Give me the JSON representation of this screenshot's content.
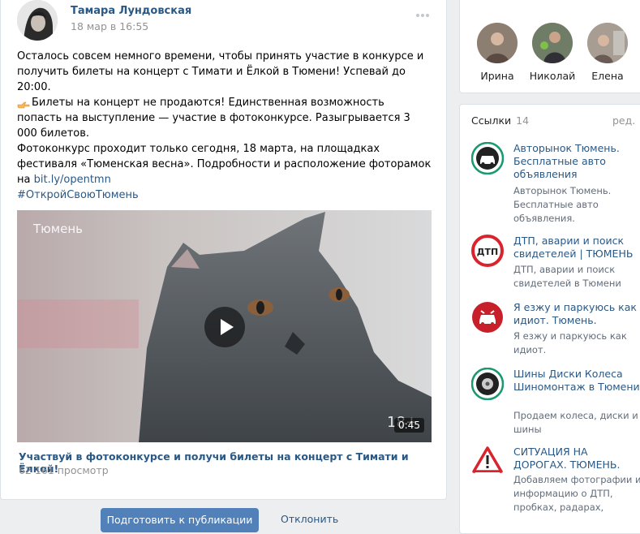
{
  "post": {
    "author": "Тамара Лундовская",
    "date": "18 мар в 16:55",
    "para1": "Осталось совсем немного времени, чтобы принять участие в конкурсе и получить билеты на концерт с Тимати и Ёлкой в Тюмени! Успевай до 20:00.",
    "para2": "Билеты на концерт не продаются! Единственная возможность попасть на выступление — участие в фотоконкурсе. Разыгрывается 3 000 билетов.",
    "para3_prefix": "Фотоконкурс проходит только сегодня, 18 марта, на площадках фестиваля «Тюменская весна». Подробности и расположение фоторамок на ",
    "para3_link": "bit.ly/opentmn",
    "hashtag": "#ОткройСвоюТюмень",
    "video": {
      "overlay_city": "Тюмень",
      "age_label": "18+",
      "duration": "0:45",
      "title": "Участвуй в фотоконкурсе и получи билеты на концерт с Тимати и Ёлкой!",
      "views": "62 161 просмотр"
    },
    "buttons": {
      "publish": "Подготовить к публикации",
      "reject": "Отклонить"
    }
  },
  "sidebar": {
    "friends": [
      {
        "name": "Ирина"
      },
      {
        "name": "Николай"
      },
      {
        "name": "Елена"
      }
    ],
    "links": {
      "title": "Ссылки",
      "count": "14",
      "edit": "ред.",
      "items": [
        {
          "icon": "car-icon",
          "name": "Авторынок Тюмень. Бесплатные авто объявления",
          "desc": "Авторынок Тюмень. Бесплатные авто объявления."
        },
        {
          "icon": "dtp-icon",
          "name": "ДТП, аварии и поиск свидетелей | ТЮМЕНЬ",
          "desc": "ДТП, аварии и поиск свидетелей в Тюмени"
        },
        {
          "icon": "parking-icon",
          "name": "Я езжу и паркуюсь как идиот. Тюмень.",
          "desc": "Я езжу и паркуюсь как идиот."
        },
        {
          "icon": "tire-icon",
          "name": "Шины Диски Колеса Шиномонтаж в Тюмени",
          "desc": "Продаем колеса, диски и шины"
        },
        {
          "icon": "warning-icon",
          "name": "СИТУАЦИЯ НА ДОРОГАХ. ТЮМЕНЬ.",
          "desc": "Добавляем фотографии и информацию о ДТП, пробках, радарах,"
        }
      ]
    }
  },
  "colors": {
    "link": "#2a5885",
    "button": "#5181b8",
    "background": "#edeef0",
    "muted": "#939393"
  }
}
